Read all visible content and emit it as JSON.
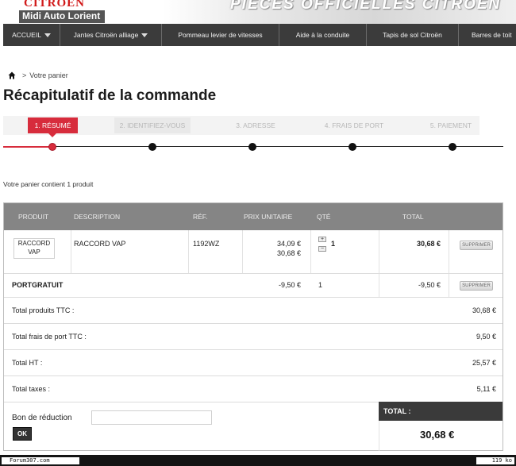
{
  "header": {
    "brand": "CITROËN",
    "dealer": "Midi Auto Lorient",
    "banner": "PIÈCES OFFICIELLES CITROËN"
  },
  "nav": {
    "items": [
      {
        "label": "ACCUEIL",
        "dropdown": true
      },
      {
        "label": "Jantes Citroën alliage",
        "dropdown": true
      },
      {
        "label": "Pommeau levier de vitesses",
        "dropdown": false
      },
      {
        "label": "Aide à la conduite",
        "dropdown": false
      },
      {
        "label": "Tapis de sol Citroën",
        "dropdown": false
      },
      {
        "label": "Barres de toit",
        "dropdown": false
      }
    ]
  },
  "breadcrumb": {
    "current": "Votre panier"
  },
  "page_title": "Récapitulatif de la commande",
  "steps": [
    {
      "label": "1. RÉSUMÉ",
      "active": true
    },
    {
      "label": "2. IDENTIFIEZ-VOUS",
      "active": false
    },
    {
      "label": "3. ADRESSE",
      "active": false
    },
    {
      "label": "4. FRAIS DE PORT",
      "active": false
    },
    {
      "label": "5. PAIEMENT",
      "active": false
    }
  ],
  "cart_count": "Votre panier contient 1 produit",
  "table": {
    "headers": {
      "product": "PRODUIT",
      "description": "DESCRIPTION",
      "ref": "RÉF.",
      "unit_price": "PRIX UNITAIRE",
      "qty": "QTÉ",
      "total": "TOTAL"
    },
    "items": [
      {
        "thumb": "RACCORD VAP",
        "description": "RACCORD VAP",
        "ref": "1192WZ",
        "old_price": "34,09 €",
        "price": "30,68 €",
        "qty": "1",
        "total": "30,68 €",
        "delete": "SUPPRIMER"
      }
    ],
    "discount": {
      "name": "PORTGRATUIT",
      "price": "-9,50 €",
      "qty": "1",
      "total": "-9,50 €",
      "delete": "SUPPRIMER"
    },
    "summary": [
      {
        "label": "Total produits TTC :",
        "value": "30,68 €"
      },
      {
        "label": "Total frais de port TTC :",
        "value": "9,50 €"
      },
      {
        "label": "Total HT :",
        "value": "25,57 €"
      },
      {
        "label": "Total taxes :",
        "value": "5,11 €"
      }
    ],
    "coupon": {
      "label": "Bon de réduction",
      "value": "",
      "button": "OK"
    },
    "grand_total": {
      "label": "TOTAL :",
      "value": "30,68 €"
    }
  },
  "footer": {
    "left": "Forum307.com",
    "right": "119 ko"
  }
}
